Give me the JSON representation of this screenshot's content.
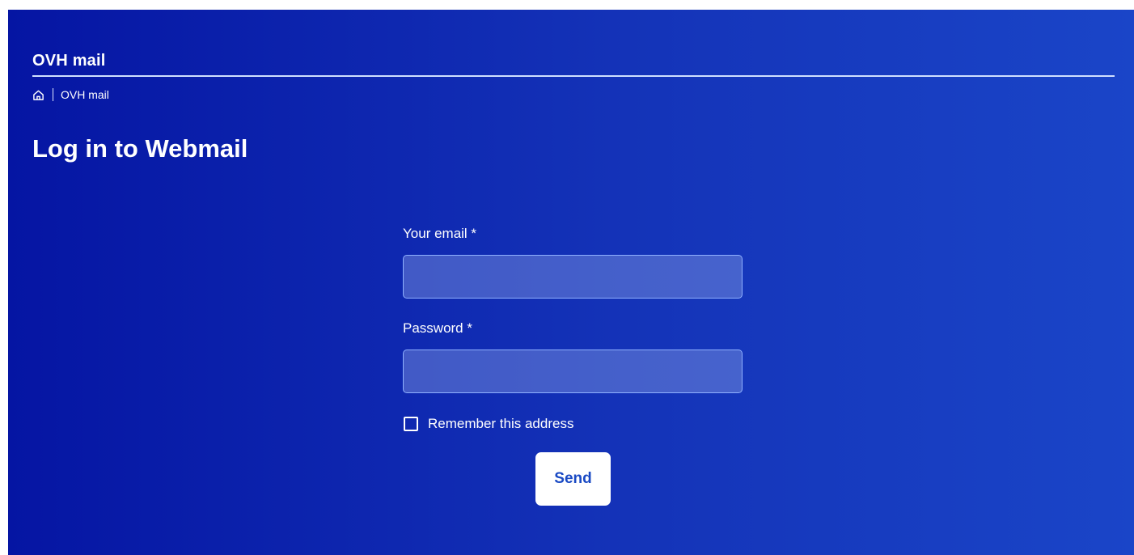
{
  "header": {
    "app_title": "OVH mail"
  },
  "breadcrumb": {
    "home_icon": "home-icon",
    "current": "OVH mail"
  },
  "page": {
    "title": "Log in to Webmail"
  },
  "form": {
    "email_label": "Your email *",
    "email_value": "",
    "password_label": "Password *",
    "password_value": "",
    "remember_label": "Remember this address",
    "remember_checked": false,
    "send_label": "Send"
  },
  "colors": {
    "background_start": "#0515a3",
    "background_end": "#1a45c8",
    "button_text": "#1a4ac4"
  }
}
